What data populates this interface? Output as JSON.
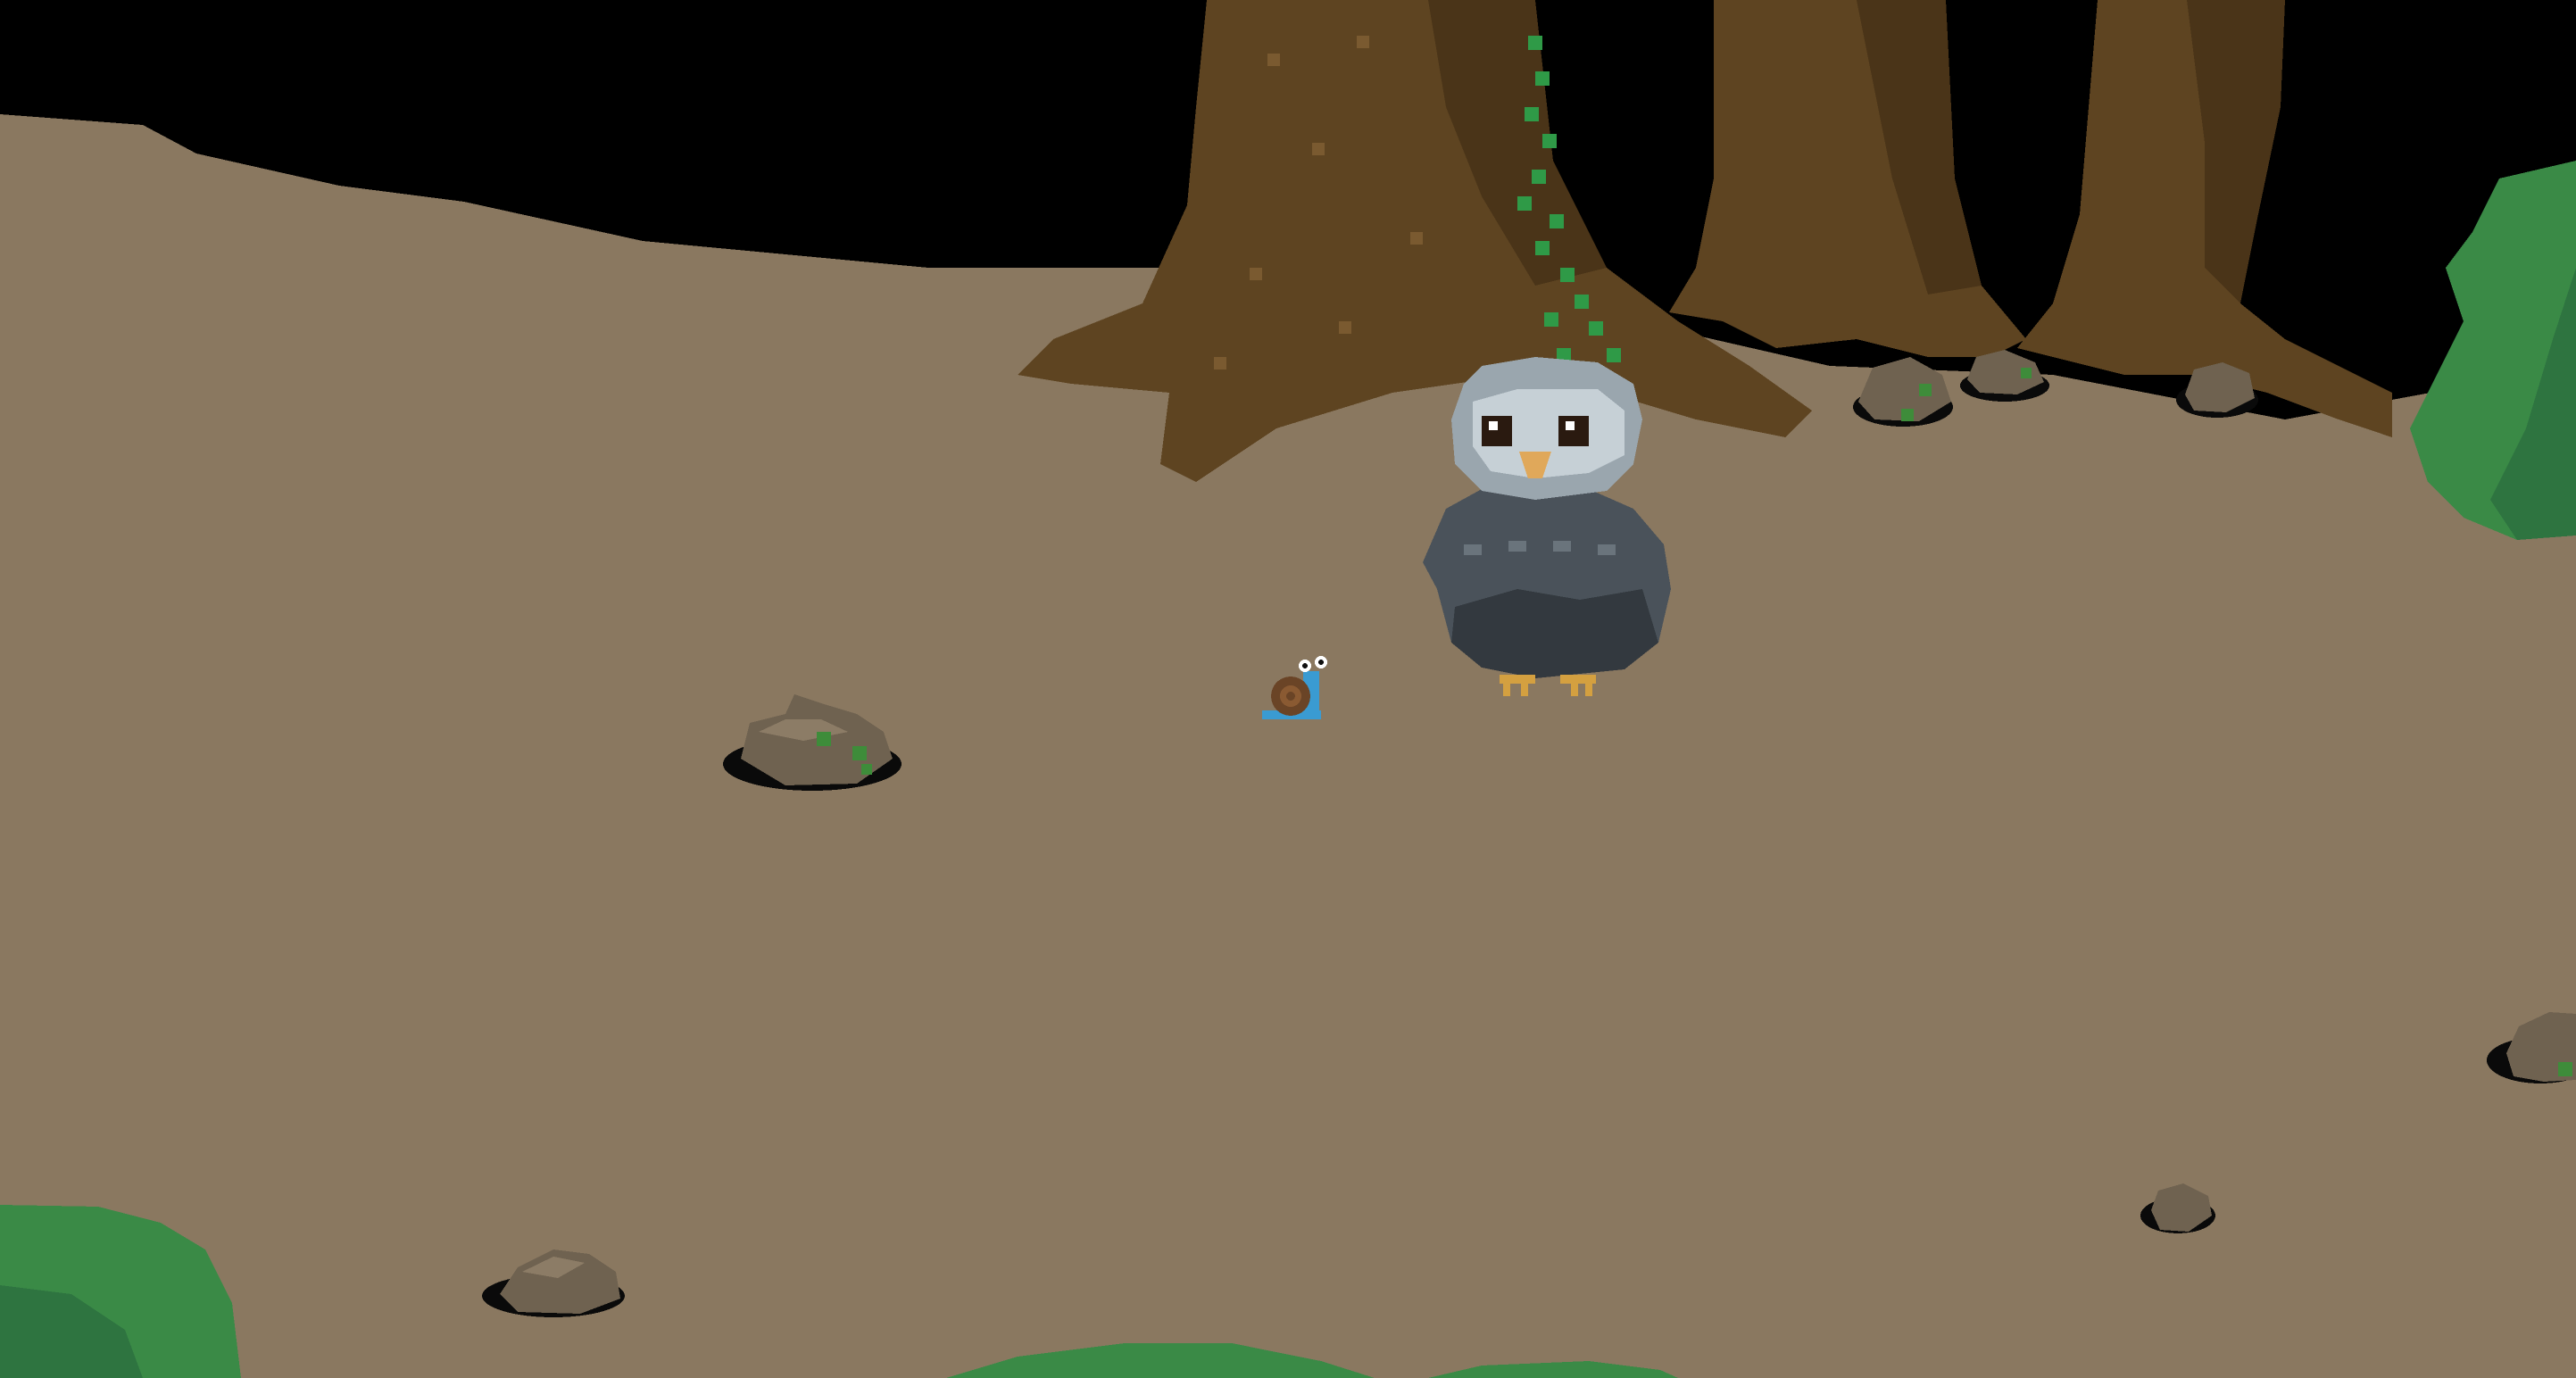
{
  "scene": {
    "type": "top-down pixel-art forest clearing",
    "colors": {
      "void": "#000000",
      "ground": "#8a7860",
      "trunk": "#5e4421",
      "trunk_dark": "#4a3418",
      "trunk_light": "#7a5a30",
      "rock": "#6f6250",
      "rock_light": "#8c7c66",
      "rock_shadow": "#0a0a0a",
      "moss": "#3e8c3a",
      "ivy": "#2f9a47",
      "bush": "#3a8a46",
      "bush_dark": "#2e7440",
      "owl_head": "#9aa6ae",
      "owl_face": "#c6d0d6",
      "owl_body": "#4a525a",
      "owl_body_dark": "#33393f",
      "owl_beak": "#e0a85a",
      "owl_feet": "#d4a040",
      "snail_shell": "#6a4426",
      "snail_body": "#3a9bd2"
    },
    "sprites": [
      {
        "name": "owl-npc",
        "icon": "owl-icon"
      },
      {
        "name": "snail-player",
        "icon": "snail-icon"
      },
      {
        "name": "mossy-rock",
        "icon": "rock-icon"
      },
      {
        "name": "pebble",
        "icon": "rock-icon"
      },
      {
        "name": "bush",
        "icon": "bush-icon"
      },
      {
        "name": "tree-trunk",
        "icon": "tree-icon"
      }
    ]
  }
}
